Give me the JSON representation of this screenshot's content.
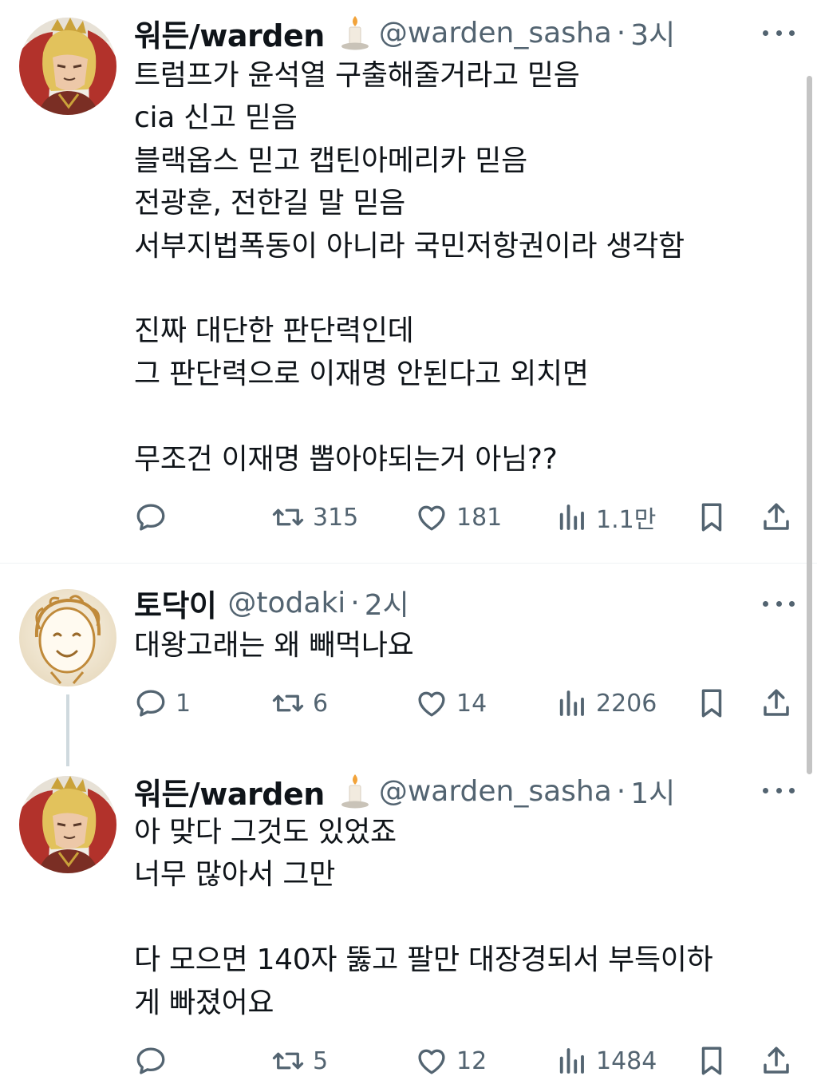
{
  "tweets": [
    {
      "name": "워든/warden",
      "badge_icon": "candle-emoji",
      "handle": "@warden_sasha",
      "separator": "·",
      "time": "3시",
      "lines": [
        "트럼프가 윤석열 구출해줄거라고 믿음",
        "cia 신고 믿음",
        "블랙옵스 믿고 캡틴아메리카 믿음",
        "전광훈, 전한길 말 믿음",
        "서부지법폭동이 아니라 국민저항권이라 생각함",
        "",
        "진짜 대단한 판단력인데",
        "그 판단력으로 이재명 안된다고 외치면",
        "",
        "무조건 이재명 뽑아야되는거 아님??"
      ],
      "actions": {
        "replies": "",
        "retweets": "315",
        "likes": "181",
        "views": "1.1만"
      }
    },
    {
      "name": "토닥이",
      "handle": "@todaki",
      "separator": "·",
      "time": "2시",
      "lines": [
        "대왕고래는 왜 빼먹나요"
      ],
      "actions": {
        "replies": "1",
        "retweets": "6",
        "likes": "14",
        "views": "2206"
      }
    },
    {
      "name": "워든/warden",
      "badge_icon": "candle-emoji",
      "handle": "@warden_sasha",
      "separator": "·",
      "time": "1시",
      "lines": [
        "아 맞다 그것도 있었죠",
        "너무 많아서 그만",
        "",
        "다 모으면 140자 뚫고 팔만 대장경되서 부득이하",
        "게 빠졌어요"
      ],
      "actions": {
        "replies": "",
        "retweets": "5",
        "likes": "12",
        "views": "1484"
      }
    }
  ],
  "colors": {
    "text": "#0f1419",
    "secondary": "#536471",
    "divider": "#eff3f4",
    "thread_line": "#cfd9de"
  }
}
